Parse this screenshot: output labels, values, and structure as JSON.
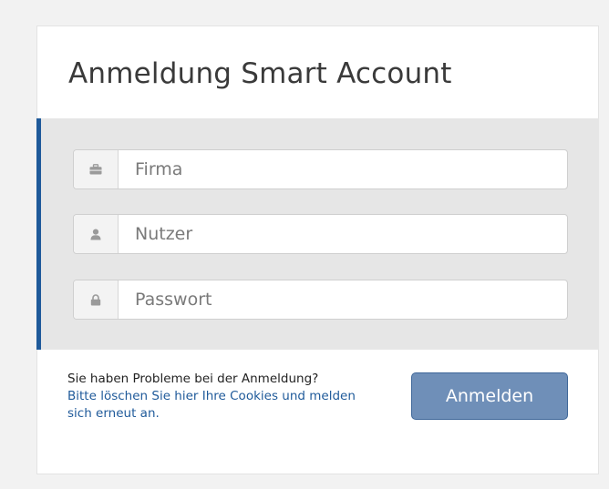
{
  "login": {
    "title": "Anmeldung Smart Account",
    "fields": [
      {
        "placeholder": "Firma",
        "icon": "briefcase-icon"
      },
      {
        "placeholder": "Nutzer",
        "icon": "user-icon"
      },
      {
        "placeholder": "Passwort",
        "icon": "lock-icon"
      }
    ],
    "help_question": "Sie haben Probleme bei der Anmeldung?",
    "help_link": "Bitte löschen Sie hier Ihre Cookies und melden sich erneut an.",
    "submit_label": "Anmelden"
  },
  "colors": {
    "accent": "#1f5a9a",
    "button": "#6f8fb8",
    "form_background": "#e6e6e6"
  }
}
